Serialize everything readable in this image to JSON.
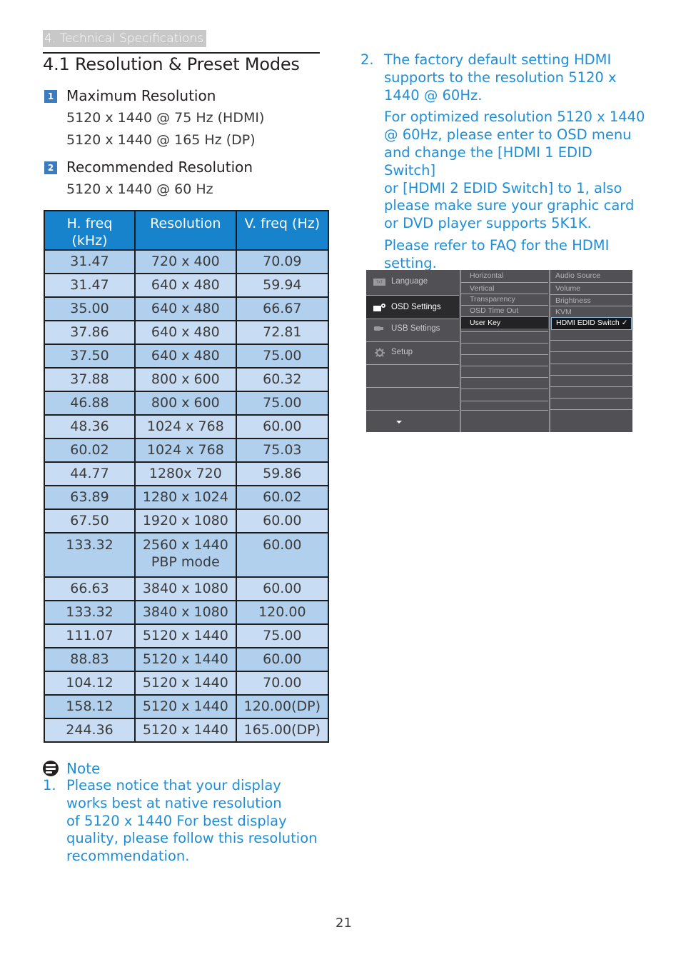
{
  "header": {
    "section_tag": "4. Technical Specifications",
    "page_title": "4.1  Resolution & Preset Modes"
  },
  "specs": [
    {
      "number": "1",
      "heading": "Maximum Resolution",
      "lines": [
        "5120 x 1440 @ 75 Hz (HDMI)",
        "5120 x 1440 @ 165 Hz (DP)"
      ]
    },
    {
      "number": "2",
      "heading": "Recommended Resolution",
      "lines": [
        "5120 x 1440 @ 60 Hz"
      ]
    }
  ],
  "table": {
    "headers": [
      "H. freq\n(kHz)",
      "Resolution",
      "V. freq (Hz)"
    ],
    "rows": [
      [
        "31.47",
        "720 x 400",
        "70.09"
      ],
      [
        "31.47",
        "640 x 480",
        "59.94"
      ],
      [
        "35.00",
        "640 x 480",
        "66.67"
      ],
      [
        "37.86",
        "640 x 480",
        "72.81"
      ],
      [
        "37.50",
        "640 x 480",
        "75.00"
      ],
      [
        "37.88",
        "800 x 600",
        "60.32"
      ],
      [
        "46.88",
        "800 x 600",
        "75.00"
      ],
      [
        "48.36",
        "1024 x 768",
        "60.00"
      ],
      [
        "60.02",
        "1024 x 768",
        "75.03"
      ],
      [
        "44.77",
        "1280x 720",
        "59.86"
      ],
      [
        "63.89",
        "1280 x 1024",
        "60.02"
      ],
      [
        "67.50",
        "1920 x 1080",
        "60.00"
      ],
      [
        "133.32",
        "2560 x 1440\nPBP mode",
        "60.00"
      ],
      [
        "66.63",
        "3840 x 1080",
        "60.00"
      ],
      [
        "133.32",
        "3840 x 1080",
        "120.00"
      ],
      [
        "111.07",
        "5120 x 1440",
        "75.00"
      ],
      [
        "88.83",
        "5120 x 1440",
        "60.00"
      ],
      [
        "104.12",
        "5120 x 1440",
        "70.00"
      ],
      [
        "158.12",
        "5120 x 1440",
        "120.00(DP)"
      ],
      [
        "244.36",
        "5120 x 1440",
        "165.00(DP)"
      ]
    ]
  },
  "note": {
    "label": "Note",
    "items": [
      {
        "number": "1.",
        "paragraphs": [
          "Please notice that your display\nworks best at native resolution\nof 5120 x 1440 For best display\nquality, please follow this resolution\nrecommendation."
        ]
      },
      {
        "number": "2.",
        "paragraphs": [
          "The factory default setting HDMI\nsupports to the resolution 5120 x\n1440 @ 60Hz.",
          "For optimized resolution 5120 x 1440\n@ 60Hz, please enter to OSD menu\nand change the [HDMI 1 EDID Switch]\nor [HDMI 2 EDID Switch] to 1, also\nplease make sure your graphic card\nor DVD player supports 5K1K.",
          "Please refer to FAQ for the HDMI\nsetting."
        ]
      }
    ]
  },
  "osd": {
    "main_menu": [
      {
        "label": "Language",
        "icon": "language-icon",
        "active": false
      },
      {
        "label": "OSD Settings",
        "icon": "osd-settings-icon",
        "active": true
      },
      {
        "label": "USB Settings",
        "icon": "usb-icon",
        "active": false
      },
      {
        "label": "Setup",
        "icon": "gear-icon",
        "active": false
      }
    ],
    "submenu": [
      "Horizontal",
      "Vertical",
      "Transparency",
      "OSD Time Out",
      "User Key"
    ],
    "submenu_active": "User Key",
    "options": [
      "Audio Source",
      "Volume",
      "Brightness",
      "KVM",
      "HDMI EDID Switch"
    ],
    "option_selected": "HDMI EDID Switch",
    "check_glyph": "✓",
    "scroll_icon": "chevron-down-icon"
  },
  "footer": {
    "page_number": "21"
  }
}
